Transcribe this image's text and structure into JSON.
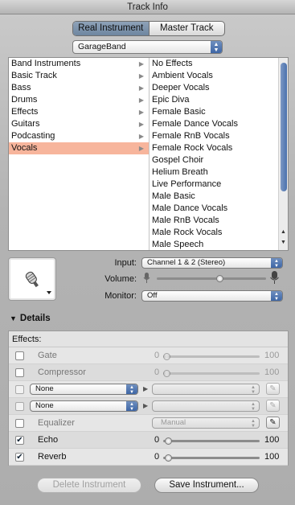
{
  "window": {
    "title": "Track Info"
  },
  "segment": {
    "real_instrument": "Real Instrument",
    "master_track": "Master Track"
  },
  "library_popup": "GarageBand",
  "categories": [
    "Band Instruments",
    "Basic Track",
    "Bass",
    "Drums",
    "Effects",
    "Guitars",
    "Podcasting",
    "Vocals"
  ],
  "presets": [
    "No Effects",
    "Ambient Vocals",
    "Deeper Vocals",
    "Epic Diva",
    "Female Basic",
    "Female Dance Vocals",
    "Female RnB Vocals",
    "Female Rock Vocals",
    "Gospel Choir",
    "Helium Breath",
    "Live Performance",
    "Male Basic",
    "Male Dance Vocals",
    "Male RnB Vocals",
    "Male Rock Vocals",
    "Male Speech"
  ],
  "io": {
    "input_label": "Input:",
    "input_value": "Channel 1 & 2 (Stereo)",
    "volume_label": "Volume:",
    "volume_level": 0.58,
    "monitor_label": "Monitor:",
    "monitor_value": "Off"
  },
  "details": {
    "header": "Details",
    "effects_label": "Effects:"
  },
  "effects": {
    "gate": {
      "name": "Gate",
      "min": "0",
      "max": "100"
    },
    "compressor": {
      "name": "Compressor",
      "min": "0",
      "max": "100"
    },
    "slot1": {
      "value": "None"
    },
    "slot2": {
      "value": "None"
    },
    "equalizer": {
      "name": "Equalizer",
      "preset": "Manual"
    },
    "echo": {
      "name": "Echo",
      "min": "0",
      "max": "100",
      "checked": "✔"
    },
    "reverb": {
      "name": "Reverb",
      "min": "0",
      "max": "100",
      "checked": "✔"
    }
  },
  "buttons": {
    "delete": "Delete Instrument",
    "save": "Save Instrument..."
  }
}
